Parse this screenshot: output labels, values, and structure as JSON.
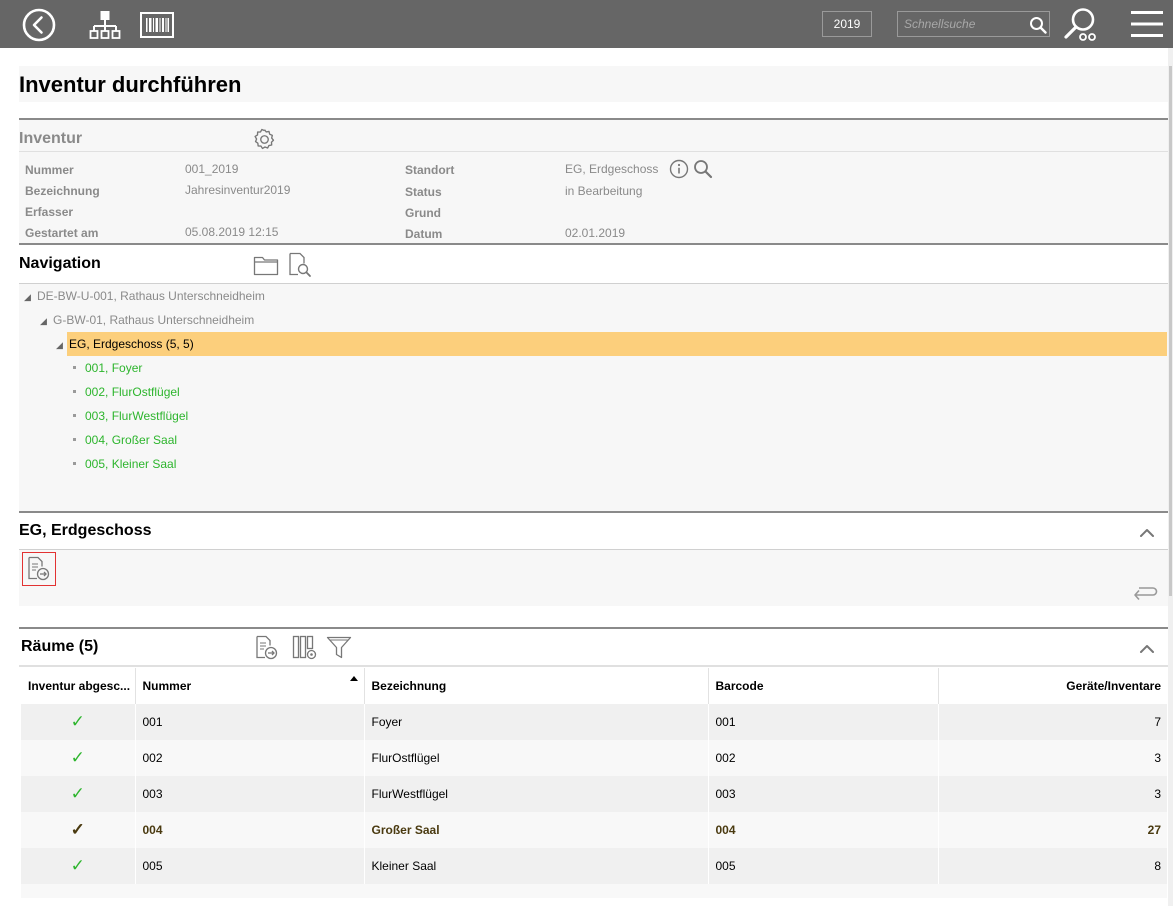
{
  "topbar": {
    "year": "2019",
    "search_placeholder": "Schnellsuche"
  },
  "page": {
    "title": "Inventur durchführen"
  },
  "inventur": {
    "title": "Inventur",
    "fields": [
      {
        "label": "Nummer",
        "value": "001_2019"
      },
      {
        "label": "Bezeichnung",
        "value": "Jahresinventur2019"
      },
      {
        "label": "Erfasser",
        "value": ""
      },
      {
        "label": "Gestartet am",
        "value": "05.08.2019 12:15"
      },
      {
        "label": "Standort",
        "value": "EG, Erdgeschoss"
      },
      {
        "label": "Status",
        "value": "in Bearbeitung"
      },
      {
        "label": "Grund",
        "value": ""
      },
      {
        "label": "Datum",
        "value": "02.01.2019"
      }
    ]
  },
  "navigation": {
    "title": "Navigation",
    "tree": {
      "level1": "DE-BW-U-001, Rathaus Unterschneidheim",
      "level2": "G-BW-01, Rathaus Unterschneidheim",
      "selected": "EG, Erdgeschoss (5, 5)",
      "leaves": [
        "001, Foyer",
        "002, FlurOstflügel",
        "003, FlurWestflügel",
        "004, Großer Saal",
        "005, Kleiner Saal"
      ]
    }
  },
  "detail": {
    "title": "EG, Erdgeschoss"
  },
  "rooms": {
    "title": "Räume (5)",
    "columns": [
      "Inventur abgesc...",
      "Nummer",
      "Bezeichnung",
      "Barcode",
      "Geräte/Inventare"
    ],
    "rows": [
      {
        "done": "✓",
        "nummer": "001",
        "bezeichnung": "Foyer",
        "barcode": "001",
        "count": "7"
      },
      {
        "done": "✓",
        "nummer": "002",
        "bezeichnung": "FlurOstflügel",
        "barcode": "002",
        "count": "3"
      },
      {
        "done": "✓",
        "nummer": "003",
        "bezeichnung": "FlurWestflügel",
        "barcode": "003",
        "count": "3"
      },
      {
        "done": "✓",
        "nummer": "004",
        "bezeichnung": "Großer Saal",
        "barcode": "004",
        "count": "27"
      },
      {
        "done": "✓",
        "nummer": "005",
        "bezeichnung": "Kleiner Saal",
        "barcode": "005",
        "count": "8"
      }
    ]
  },
  "colors": {
    "topbar": "#666666",
    "selection": "#fccf7c",
    "leaf_green": "#2db52d",
    "action_border": "#e23232"
  }
}
